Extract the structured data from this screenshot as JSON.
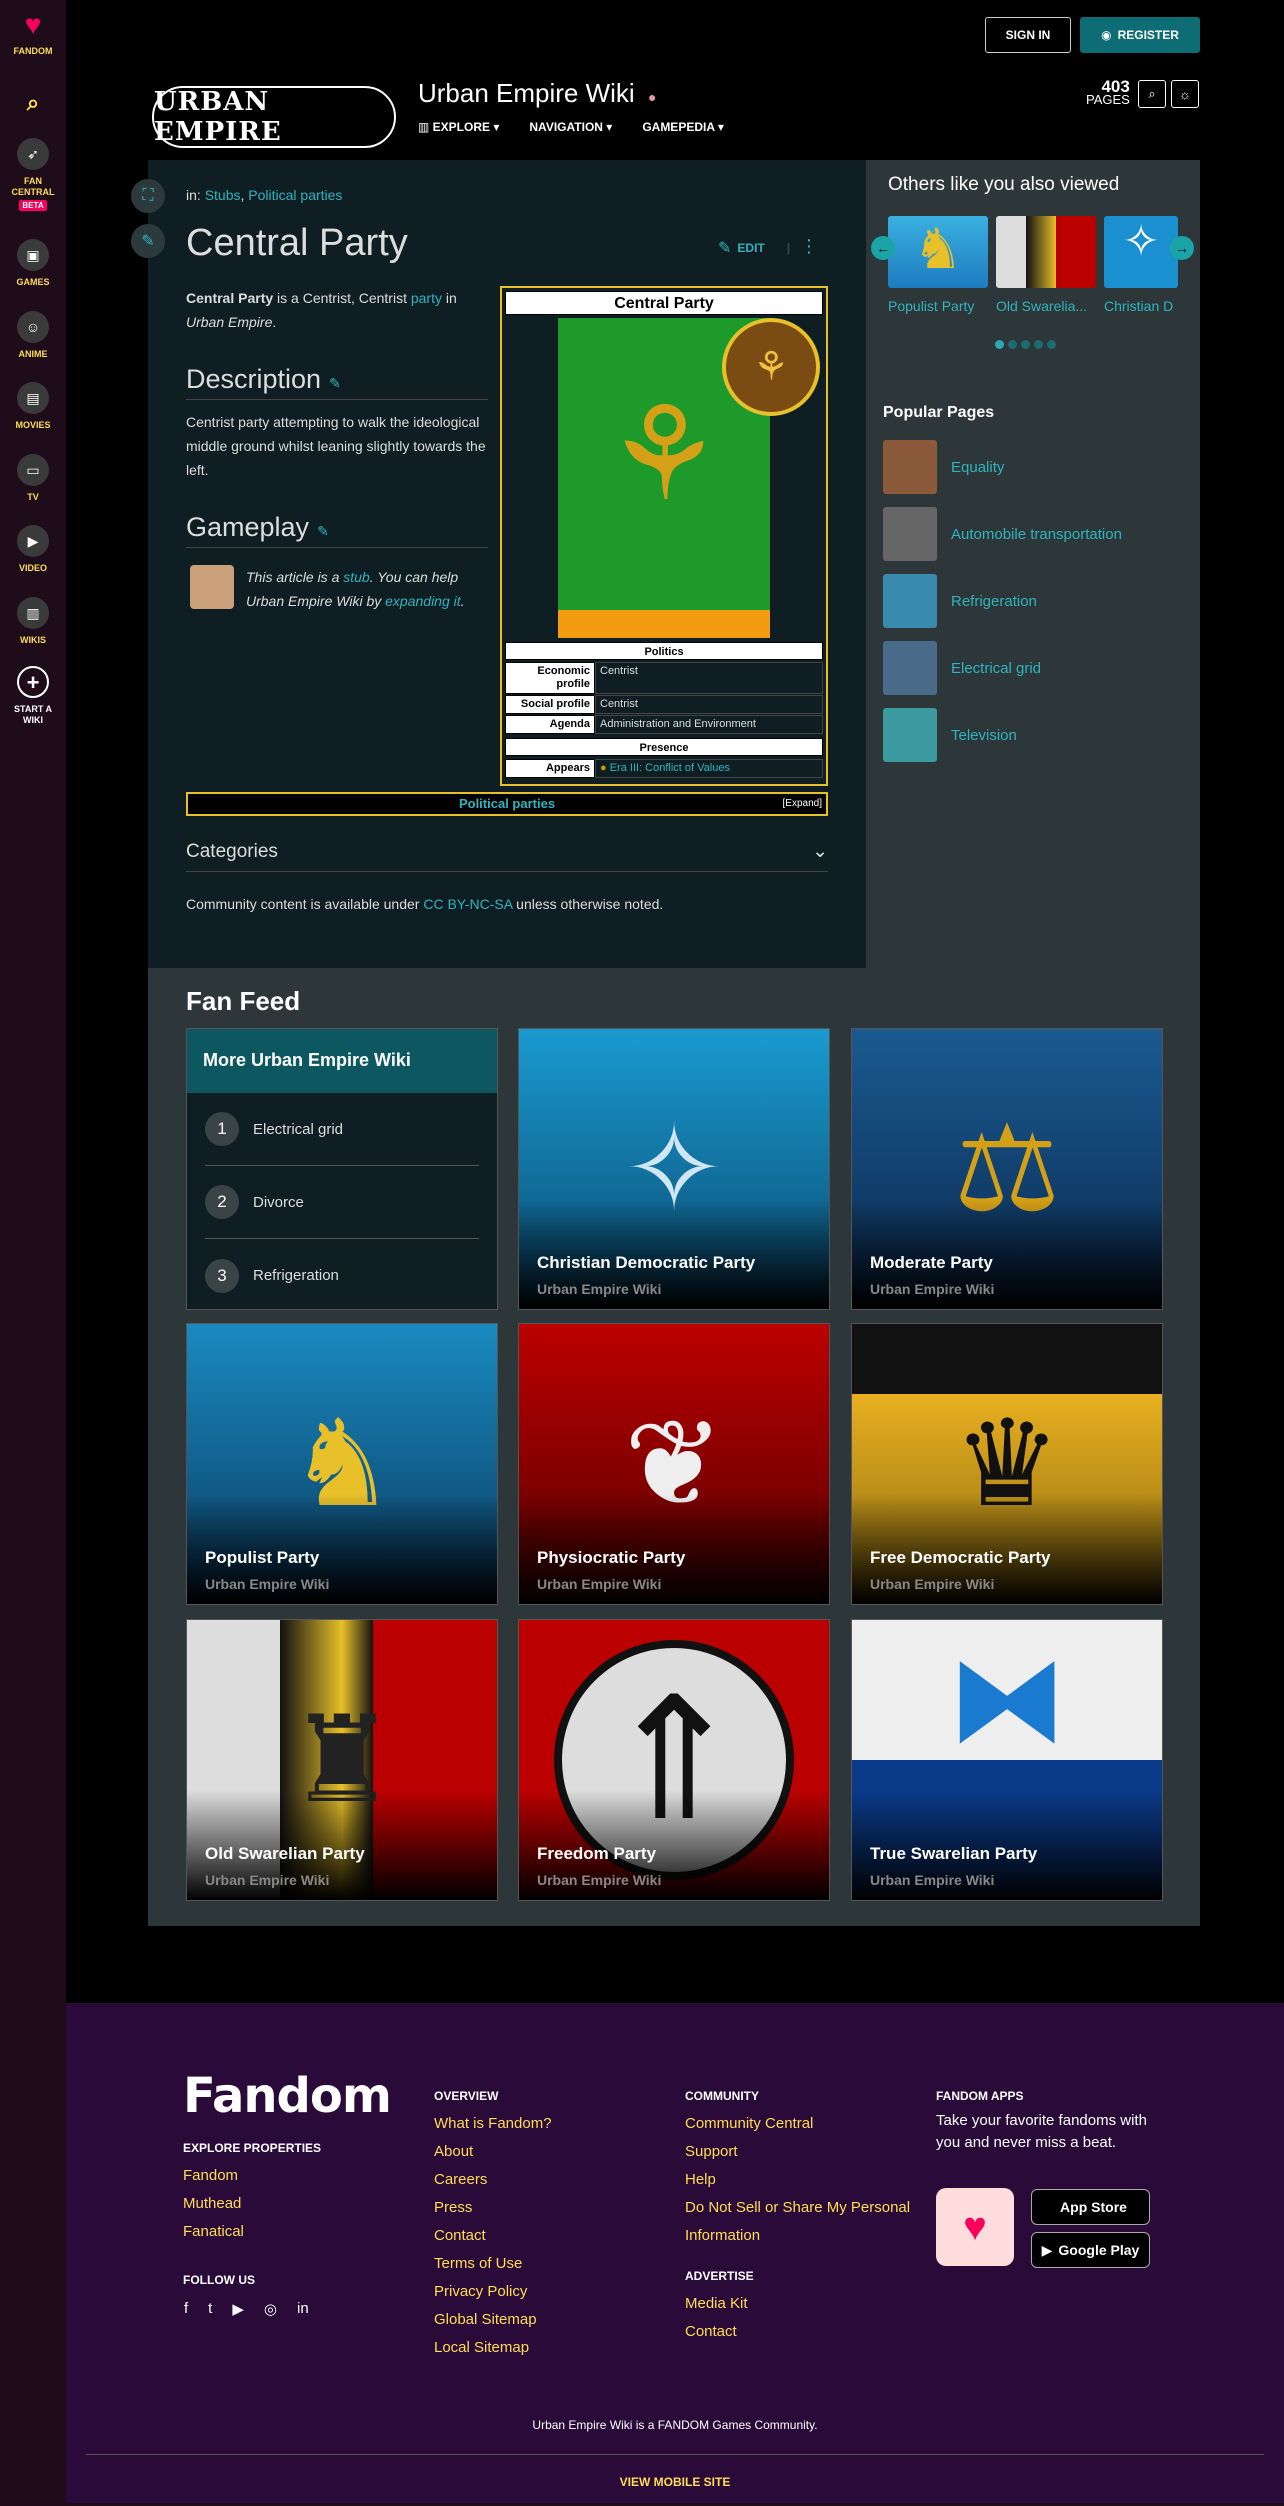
{
  "rail": {
    "items": [
      {
        "label": "FANDOM",
        "icon": "fandom-heart-icon"
      },
      {
        "label": "",
        "icon": "search-icon"
      },
      {
        "label": "FAN CENTRAL",
        "icon": "rocket-icon",
        "badge": "BETA"
      },
      {
        "label": "GAMES",
        "icon": "gamepad-icon"
      },
      {
        "label": "ANIME",
        "icon": "anime-icon"
      },
      {
        "label": "MOVIES",
        "icon": "clapperboard-icon"
      },
      {
        "label": "TV",
        "icon": "tv-icon"
      },
      {
        "label": "VIDEO",
        "icon": "video-icon"
      },
      {
        "label": "WIKIS",
        "icon": "book-icon"
      },
      {
        "label": "START A WIKI",
        "icon": "plus-icon"
      }
    ]
  },
  "header": {
    "sign_in": "SIGN IN",
    "register": "REGISTER",
    "logo_text": "URBAN EMPIRE",
    "wiki_title": "Urban Empire Wiki",
    "nav": [
      "EXPLORE",
      "NAVIGATION",
      "GAMEPEDIA"
    ],
    "page_count": "403",
    "pages_label": "PAGES"
  },
  "article": {
    "crumbs_prefix": "in:",
    "crumbs": [
      "Stubs",
      "Political parties"
    ],
    "title": "Central Party",
    "edit": "EDIT",
    "intro": {
      "name": "Central Party",
      "t1": " is a Centrist, Centrist ",
      "link": "party",
      "t2": " in ",
      "game": "Urban Empire",
      "t3": "."
    },
    "description_heading": "Description",
    "description": "Centrist party attempting to walk the ideological middle ground whilst leaning slightly towards the left.",
    "gameplay_heading": "Gameplay",
    "stub": {
      "t1": "This article is a ",
      "l1": "stub",
      "t2": ". You can help Urban Empire Wiki by ",
      "l2": "expanding it",
      "t3": "."
    },
    "categories": "Categories",
    "license": {
      "t1": "Community content is available under ",
      "link": "CC BY-NC-SA",
      "t2": " unless otherwise noted."
    }
  },
  "infobox": {
    "title": "Central Party",
    "politics": "Politics",
    "rows": [
      {
        "k": "Economic profile",
        "v": "Centrist"
      },
      {
        "k": "Social profile",
        "v": "Centrist"
      },
      {
        "k": "Agenda",
        "v": "Administration and Environment"
      }
    ],
    "presence": "Presence",
    "appears_k": "Appears",
    "appears_v": "Era III: Conflict of Values",
    "colors": {
      "flag": "#1d9a2a",
      "stripe": "#f39c12",
      "border": "#e8c02a"
    }
  },
  "navbox": {
    "title": "Political parties",
    "expand": "[Expand]"
  },
  "sidebar": {
    "others_heading": "Others like you also viewed",
    "others": [
      "Populist Party",
      "Old Swarelia...",
      "Christian D"
    ],
    "popular_heading": "Popular Pages",
    "popular": [
      "Equality",
      "Automobile transportation",
      "Refrigeration",
      "Electrical grid",
      "Television"
    ]
  },
  "feed": {
    "title": "Fan Feed",
    "more_title": "More Urban Empire Wiki",
    "more": [
      {
        "n": "1",
        "t": "Electrical grid"
      },
      {
        "n": "2",
        "t": "Divorce"
      },
      {
        "n": "3",
        "t": "Refrigeration"
      }
    ],
    "cards": [
      {
        "t": "Christian Democratic Party",
        "s": "Urban Empire Wiki"
      },
      {
        "t": "Moderate Party",
        "s": "Urban Empire Wiki"
      },
      {
        "t": "Populist Party",
        "s": "Urban Empire Wiki"
      },
      {
        "t": "Physiocratic Party",
        "s": "Urban Empire Wiki"
      },
      {
        "t": "Free Democratic Party",
        "s": "Urban Empire Wiki"
      },
      {
        "t": "Old Swarelian Party",
        "s": "Urban Empire Wiki"
      },
      {
        "t": "Freedom Party",
        "s": "Urban Empire Wiki"
      },
      {
        "t": "True Swarelian Party",
        "s": "Urban Empire Wiki"
      }
    ]
  },
  "footer": {
    "logo": "Fandom",
    "explore_heading": "EXPLORE PROPERTIES",
    "explore": [
      "Fandom",
      "Muthead",
      "Fanatical"
    ],
    "follow_heading": "FOLLOW US",
    "overview_heading": "OVERVIEW",
    "overview": [
      "What is Fandom?",
      "About",
      "Careers",
      "Press",
      "Contact",
      "Terms of Use",
      "Privacy Policy",
      "Global Sitemap",
      "Local Sitemap"
    ],
    "community_heading": "COMMUNITY",
    "community": [
      "Community Central",
      "Support",
      "Help",
      "Do Not Sell or Share My Personal Information"
    ],
    "advertise_heading": "ADVERTISE",
    "advertise": [
      "Media Kit",
      "Contact"
    ],
    "apps_heading": "FANDOM APPS",
    "apps_text": "Take your favorite fandoms with you and never miss a beat.",
    "app_store": "App Store",
    "google_play": "Google Play",
    "bottom_text": "Urban Empire Wiki is a FANDOM Games Community.",
    "mobile": "VIEW MOBILE SITE"
  }
}
